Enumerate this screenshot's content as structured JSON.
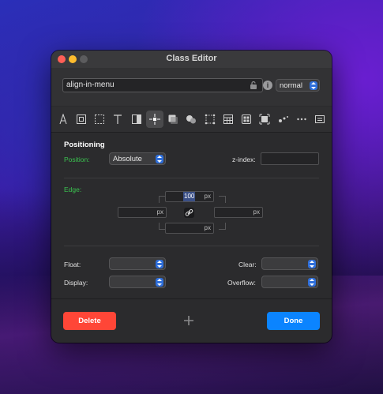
{
  "window": {
    "title": "Class Editor"
  },
  "header": {
    "class_name": "align-in-menu",
    "state_value": "normal"
  },
  "toolbar": {
    "tools": [
      {
        "name": "typography-icon"
      },
      {
        "name": "box-model-icon"
      },
      {
        "name": "border-icon"
      },
      {
        "name": "text-icon"
      },
      {
        "name": "background-icon"
      },
      {
        "name": "position-icon",
        "active": true
      },
      {
        "name": "shadow-icon"
      },
      {
        "name": "effects-icon"
      },
      {
        "name": "transform-icon"
      },
      {
        "name": "table-icon"
      },
      {
        "name": "grid-icon"
      },
      {
        "name": "flex-icon"
      },
      {
        "name": "animation-icon"
      },
      {
        "name": "more-icon"
      },
      {
        "name": "custom-css-icon"
      }
    ]
  },
  "positioning": {
    "section_title": "Positioning",
    "position_label": "Position:",
    "position_value": "Absolute",
    "zindex_label": "z-index:",
    "zindex_value": "",
    "edge_label": "Edge:",
    "edge_top_value": "100",
    "unit": "px"
  },
  "layout": {
    "float_label": "Float:",
    "clear_label": "Clear:",
    "display_label": "Display:",
    "overflow_label": "Overflow:"
  },
  "buttons": {
    "delete": "Delete",
    "done": "Done"
  },
  "colors": {
    "accent_blue": "#2f6fdb",
    "delete_red": "#ff4637",
    "done_blue": "#0b84ff",
    "label_green": "#3ac24f"
  }
}
